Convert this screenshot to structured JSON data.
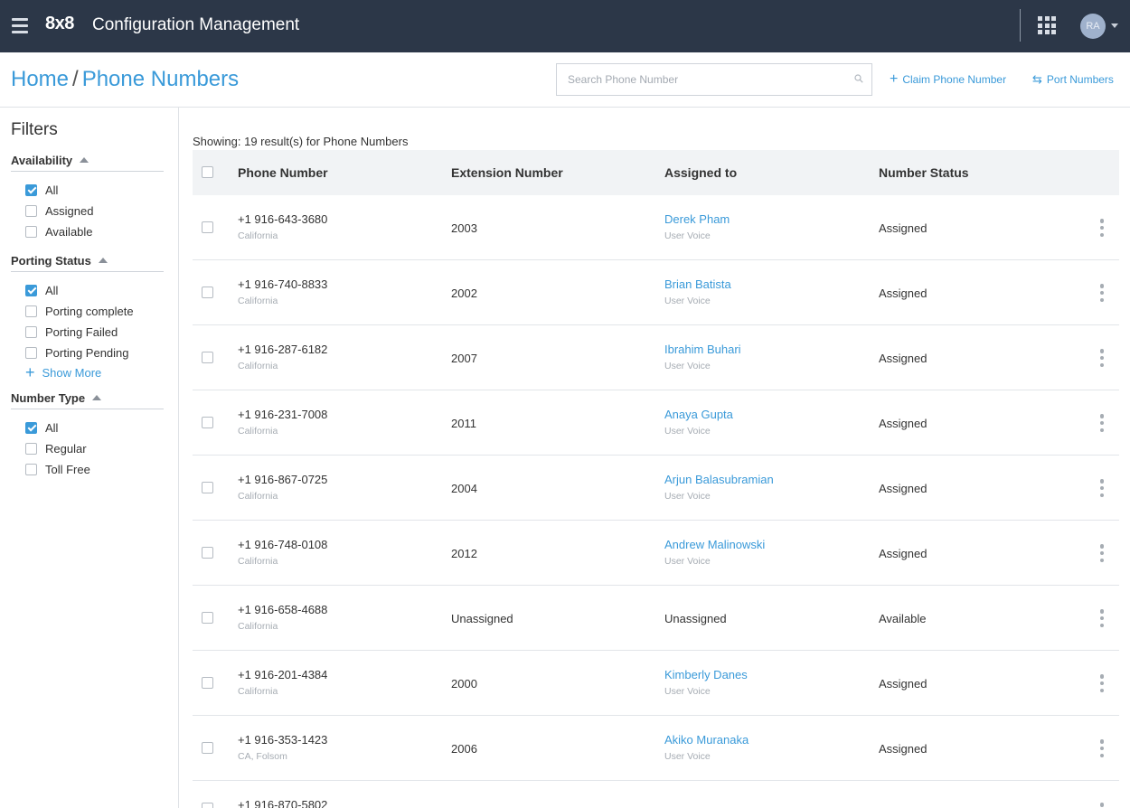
{
  "topbar": {
    "logo": "8x8",
    "title": "Configuration Management",
    "avatar_initials": "RA"
  },
  "header": {
    "breadcrumb_home": "Home",
    "breadcrumb_sep": "/",
    "breadcrumb_current": "Phone Numbers",
    "search_placeholder": "Search Phone Number",
    "claim_label": "Claim Phone Number",
    "port_label": "Port Numbers"
  },
  "filters": {
    "title": "Filters",
    "groups": [
      {
        "label": "Availability",
        "options": [
          {
            "label": "All",
            "checked": true
          },
          {
            "label": "Assigned",
            "checked": false
          },
          {
            "label": "Available",
            "checked": false
          }
        ]
      },
      {
        "label": "Porting Status",
        "options": [
          {
            "label": "All",
            "checked": true
          },
          {
            "label": "Porting complete",
            "checked": false
          },
          {
            "label": "Porting Failed",
            "checked": false
          },
          {
            "label": "Porting Pending",
            "checked": false
          }
        ],
        "show_more": "Show More"
      },
      {
        "label": "Number Type",
        "options": [
          {
            "label": "All",
            "checked": true
          },
          {
            "label": "Regular",
            "checked": false
          },
          {
            "label": "Toll Free",
            "checked": false
          }
        ]
      }
    ]
  },
  "results": {
    "label": "Showing: 19 result(s) for Phone Numbers"
  },
  "table": {
    "columns": [
      "Phone Number",
      "Extension Number",
      "Assigned to",
      "Number Status"
    ],
    "rows": [
      {
        "phone": "+1 916-643-3680",
        "location": "California",
        "extension": "2003",
        "assignee": "Derek Pham",
        "role": "User Voice",
        "status": "Assigned"
      },
      {
        "phone": "+1 916-740-8833",
        "location": "California",
        "extension": "2002",
        "assignee": "Brian Batista",
        "role": "User Voice",
        "status": "Assigned"
      },
      {
        "phone": "+1 916-287-6182",
        "location": "California",
        "extension": "2007",
        "assignee": "Ibrahim Buhari",
        "role": "User Voice",
        "status": "Assigned"
      },
      {
        "phone": "+1 916-231-7008",
        "location": "California",
        "extension": "2011",
        "assignee": "Anaya Gupta",
        "role": "User Voice",
        "status": "Assigned"
      },
      {
        "phone": "+1 916-867-0725",
        "location": "California",
        "extension": "2004",
        "assignee": "Arjun Balasubramian",
        "role": "User Voice",
        "status": "Assigned"
      },
      {
        "phone": "+1 916-748-0108",
        "location": "California",
        "extension": "2012",
        "assignee": "Andrew Malinowski",
        "role": "User Voice",
        "status": "Assigned"
      },
      {
        "phone": "+1 916-658-4688",
        "location": "California",
        "extension": "Unassigned",
        "assignee": "Unassigned",
        "role": "",
        "status": "Available"
      },
      {
        "phone": "+1 916-201-4384",
        "location": "California",
        "extension": "2000",
        "assignee": "Kimberly Danes",
        "role": "User Voice",
        "status": "Assigned"
      },
      {
        "phone": "+1 916-353-1423",
        "location": "CA, Folsom",
        "extension": "2006",
        "assignee": "Akiko Muranaka",
        "role": "User Voice",
        "status": "Assigned"
      },
      {
        "phone": "+1 916-870-5802",
        "location": "",
        "extension": "",
        "assignee": "",
        "role": "",
        "status": ""
      }
    ]
  },
  "colors": {
    "topbar_bg": "#2c3748",
    "accent": "#3a9ad9",
    "table_header_bg": "#f1f3f5"
  }
}
